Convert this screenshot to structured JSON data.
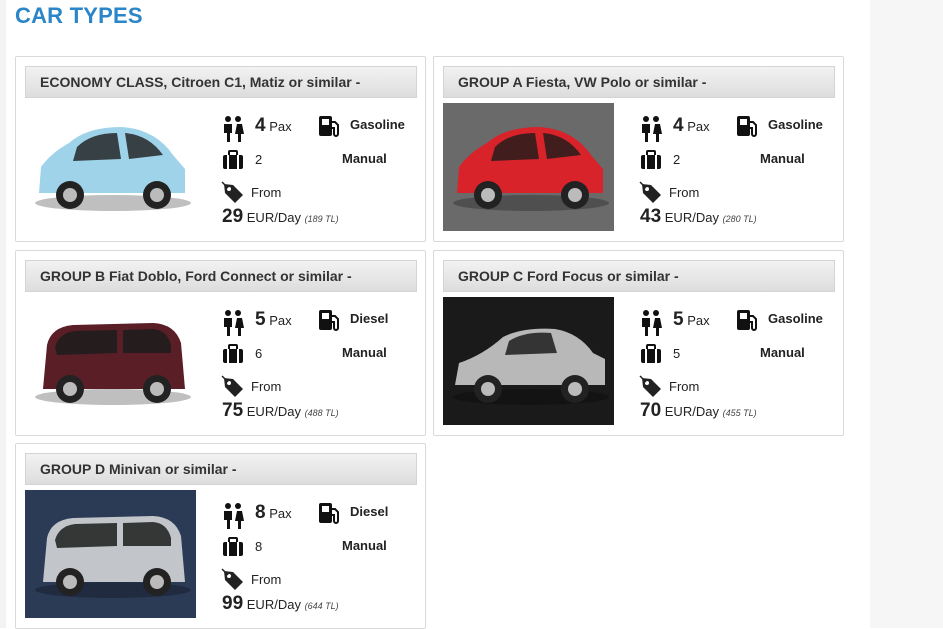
{
  "page_title": "CAR TYPES",
  "cars": [
    {
      "heading": "ECONOMY CLASS, Citroen C1, Matiz or similar -",
      "pax": "4",
      "pax_unit": "Pax",
      "fuel": "Gasoline",
      "bags": "2",
      "transmission": "Manual",
      "from_label": "From",
      "price": "29",
      "price_unit": "EUR/Day",
      "price_tl": "(189 TL)",
      "image_icon": "car-photo-light-blue-hatchback",
      "body_color": "#9fd3ea",
      "bg": "#ffffff"
    },
    {
      "heading": "GROUP A Fiesta, VW Polo or similar -",
      "pax": "4",
      "pax_unit": "Pax",
      "fuel": "Gasoline",
      "bags": "2",
      "transmission": "Manual",
      "from_label": "From",
      "price": "43",
      "price_unit": "EUR/Day",
      "price_tl": "(280 TL)",
      "image_icon": "car-photo-red-hatchback",
      "body_color": "#d8232a",
      "bg": "#6a6a6a"
    },
    {
      "heading": "GROUP B Fiat Doblo, Ford Connect or similar -",
      "pax": "5",
      "pax_unit": "Pax",
      "fuel": "Diesel",
      "bags": "6",
      "transmission": "Manual",
      "from_label": "From",
      "price": "75",
      "price_unit": "EUR/Day",
      "price_tl": "(488 TL)",
      "image_icon": "car-photo-maroon-van",
      "body_color": "#5a1e26",
      "bg": "#ffffff"
    },
    {
      "heading": "GROUP C Ford Focus or similar -",
      "pax": "5",
      "pax_unit": "Pax",
      "fuel": "Gasoline",
      "bags": "5",
      "transmission": "Manual",
      "from_label": "From",
      "price": "70",
      "price_unit": "EUR/Day",
      "price_tl": "(455 TL)",
      "image_icon": "car-photo-silver-sedan",
      "body_color": "#b8b8b8",
      "bg": "#1a1a1a"
    },
    {
      "heading": "GROUP D Minivan or similar -",
      "pax": "8",
      "pax_unit": "Pax",
      "fuel": "Diesel",
      "bags": "8",
      "transmission": "Manual",
      "from_label": "From",
      "price": "99",
      "price_unit": "EUR/Day",
      "price_tl": "(644 TL)",
      "image_icon": "car-photo-silver-minivan",
      "body_color": "#c2c6ca",
      "bg": "#2b3a55"
    }
  ],
  "colors": {
    "title": "#2a86c8",
    "card_border": "#d9d9d9"
  }
}
